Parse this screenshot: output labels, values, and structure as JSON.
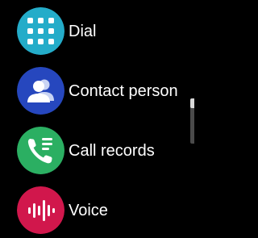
{
  "menu": {
    "items": [
      {
        "label": "Dial",
        "icon": "dialpad-icon",
        "color": "#24ACC9"
      },
      {
        "label": "Contact person",
        "icon": "contact-person-icon",
        "color": "#2647BE"
      },
      {
        "label": "Call records",
        "icon": "call-records-icon",
        "color": "#2BAF62"
      },
      {
        "label": "Voice",
        "icon": "voice-icon",
        "color": "#D1174C"
      }
    ]
  },
  "scrollbar": {
    "position": 0.0
  }
}
